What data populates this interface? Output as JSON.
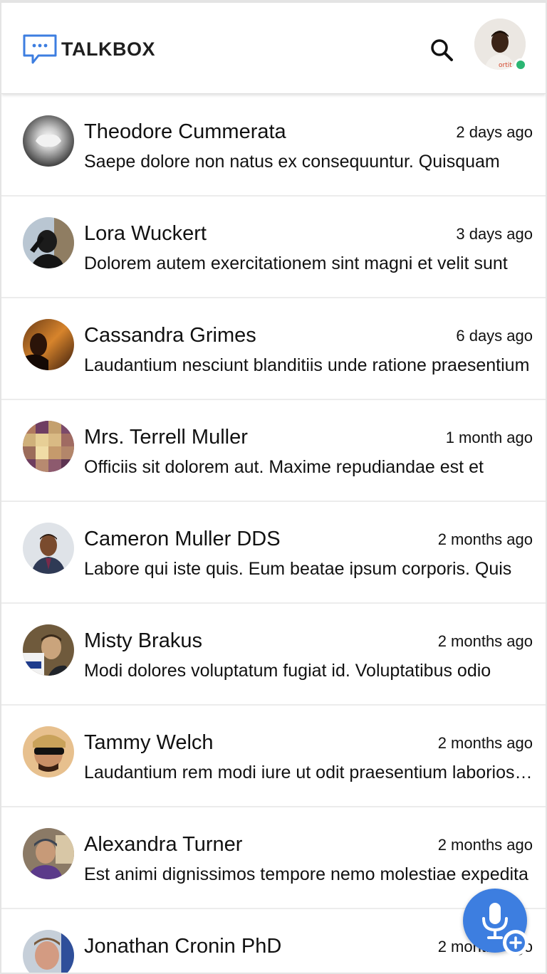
{
  "app": {
    "name": "TALKBOX"
  },
  "header": {
    "logo_text": "TALKBOX",
    "search_icon": "search-icon",
    "profile_status": "online",
    "status_color": "#2bb673"
  },
  "conversations": [
    {
      "name": "Theodore Cummerata",
      "time": "2 days ago",
      "preview": "Saepe dolore non natus ex consequuntur. Quisquam"
    },
    {
      "name": "Lora Wuckert",
      "time": "3 days ago",
      "preview": "Dolorem autem exercitationem sint magni et velit sunt"
    },
    {
      "name": "Cassandra Grimes",
      "time": "6 days ago",
      "preview": "Laudantium nesciunt blanditiis unde ratione praesentium"
    },
    {
      "name": "Mrs. Terrell Muller",
      "time": "1 month ago",
      "preview": "Officiis sit dolorem aut. Maxime repudiandae est et"
    },
    {
      "name": "Cameron Muller DDS",
      "time": "2 months ago",
      "preview": "Labore qui iste quis. Eum beatae ipsum corporis. Quis"
    },
    {
      "name": "Misty Brakus",
      "time": "2 months ago",
      "preview": "Modi dolores voluptatum fugiat id. Voluptatibus odio"
    },
    {
      "name": "Tammy Welch",
      "time": "2 months ago",
      "preview": "Laudantium rem modi iure ut odit praesentium laboriosam"
    },
    {
      "name": "Alexandra Turner",
      "time": "2 months ago",
      "preview": "Est animi dignissimos tempore nemo molestiae expedita"
    },
    {
      "name": "Jonathan Cronin PhD",
      "time": "2 months ago",
      "preview": ""
    }
  ],
  "fab": {
    "icon": "microphone-icon",
    "badge_icon": "plus-icon",
    "color": "#3d7ee0"
  },
  "colors": {
    "accent": "#3d7ee0",
    "divider": "#ececec",
    "online": "#2bb673"
  }
}
